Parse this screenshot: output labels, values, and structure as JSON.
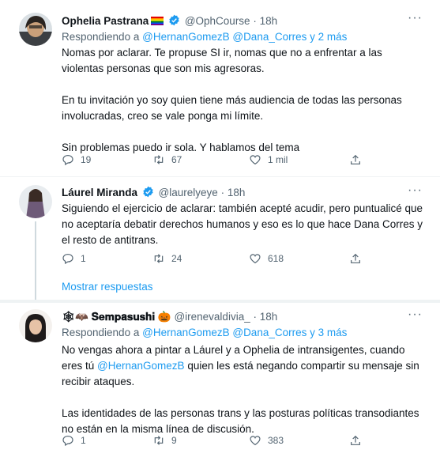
{
  "tweets": [
    {
      "name": "Ophelia Pastrana",
      "flag": "🏳️‍🌈",
      "handle": "@OphCourse",
      "time": "· 18h",
      "replying_prefix": "Respondiendo a",
      "replying_to": "@HernanGomezB @Dana_Corres y 2 más",
      "paragraphs": [
        "Nomas por aclarar. Te propuse SI ir, nomas que no a enfrentar a las violentas personas que son mis agresoras.",
        "En tu invitación yo soy quien tiene más audiencia de todas las personas involucradas, creo se vale ponga mi límite.",
        "Sin problemas puedo ir sola. Y hablamos del tema"
      ],
      "replies": "19",
      "retweets": "67",
      "likes": "1 mil"
    },
    {
      "name": "Láurel Miranda",
      "handle": "@laurelyeye",
      "time": "· 18h",
      "paragraphs": [
        "Siguiendo el ejercicio de aclarar: también acepté acudir, pero puntualicé que no aceptaría debatir derechos humanos y eso es lo que hace Dana Corres y el resto de antitrans."
      ],
      "replies": "1",
      "retweets": "24",
      "likes": "618"
    },
    {
      "name_prefix": "🕸🦇",
      "name": "𝐒𝐞𝐦𝐩𝐚𝐬𝐮𝐬𝐡𝐢",
      "name_suffix": "🎃",
      "handle": "@irenevaldivia_",
      "time": "· 18h",
      "replying_prefix": "Respondiendo a",
      "replying_to": "@HernanGomezB @Dana_Corres y 3 más",
      "paragraph1_before": "No vengas ahora a pintar a Láurel y a Ophelia de intransigentes, cuando eres tú",
      "paragraph1_mention": "@HernanGomezB",
      "paragraph1_after": "quien les está negando compartir su mensaje sin recibir ataques.",
      "paragraph2": "Las identidades de las personas trans y las posturas políticas transodiantes no están en la misma línea de discusión.",
      "replies": "1",
      "retweets": "9",
      "likes": "383"
    }
  ],
  "show_replies": "Mostrar respuestas",
  "more_icon": "···",
  "colors": {
    "accent": "#1d9bf0",
    "secondary": "#536471",
    "line": "#cfd9de"
  },
  "icons": [
    "reply-icon",
    "retweet-icon",
    "like-icon",
    "share-icon",
    "verified-badge-icon",
    "more-icon"
  ]
}
